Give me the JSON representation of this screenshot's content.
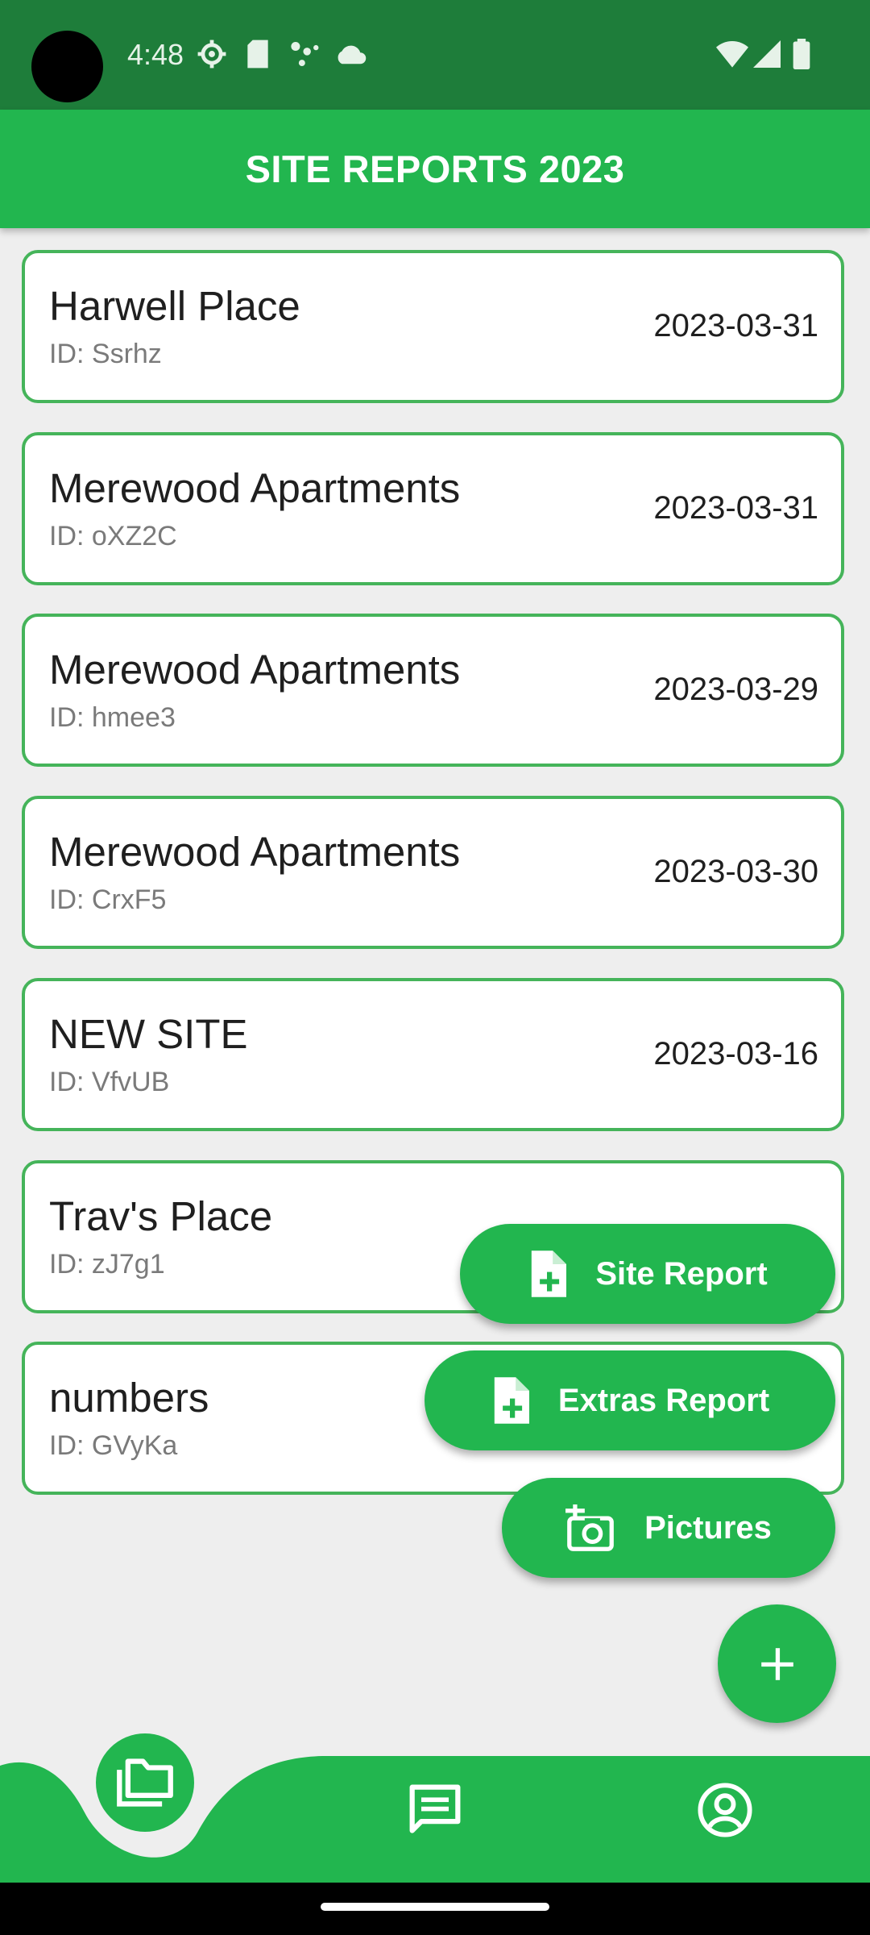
{
  "status_bar": {
    "time": "4:48",
    "icons": [
      "settings-icon",
      "sd-card-icon",
      "dots-icon",
      "cloud-icon",
      "wifi-icon",
      "signal-icon",
      "battery-icon"
    ]
  },
  "app_bar": {
    "title": "SITE REPORTS 2023"
  },
  "reports": [
    {
      "name": "Harwell Place",
      "id": "ID: Ssrhz",
      "date": "2023-03-31"
    },
    {
      "name": "Merewood Apartments",
      "id": "ID: oXZ2C",
      "date": "2023-03-31"
    },
    {
      "name": "Merewood Apartments",
      "id": "ID: hmee3",
      "date": "2023-03-29"
    },
    {
      "name": "Merewood Apartments",
      "id": "ID: CrxF5",
      "date": "2023-03-30"
    },
    {
      "name": "NEW SITE",
      "id": "ID: VfvUB",
      "date": "2023-03-16"
    },
    {
      "name": "Trav's Place",
      "id": "ID: zJ7g1",
      "date": ""
    },
    {
      "name": "numbers",
      "id": "ID: GVyKa",
      "date": ""
    }
  ],
  "fab_menu": {
    "site_report": "Site Report",
    "extras_report": "Extras Report",
    "pictures": "Pictures",
    "fab_icon": "plus-icon"
  },
  "bottom_nav": {
    "items": [
      "folders-icon",
      "messages-icon",
      "profile-icon"
    ],
    "active": "folders-icon"
  },
  "colors": {
    "primary": "#22b64f",
    "status_bar": "#1e7d3a",
    "card_border": "#45b45a",
    "background": "#eeeeee"
  }
}
